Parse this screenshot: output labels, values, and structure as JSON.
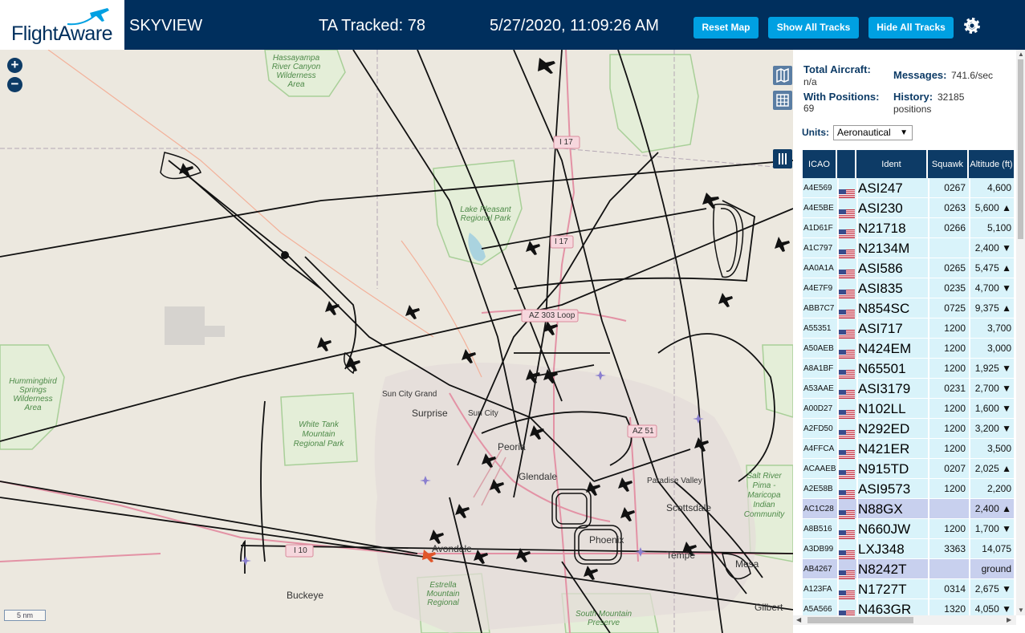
{
  "header": {
    "logo_text": "FlightAware",
    "app_name": "SKYVIEW",
    "ta_tracked": "TA Tracked: 78",
    "datetime": "5/27/2020, 11:09:26 AM",
    "reset_map_label": "Reset Map",
    "show_tracks_label": "Show All Tracks",
    "hide_tracks_label": "Hide All Tracks",
    "settings_icon": "gear-icon"
  },
  "map": {
    "zoom_in": "+",
    "zoom_out": "−",
    "scale_label": "5 nm",
    "labels": {
      "hassayampa": "Hassayampa River Canyon Wilderness Area",
      "lake_pleasant": "Lake Pleasant Regional Park",
      "hummingbird": "Hummingbird Springs Wilderness Area",
      "white_tank": "White Tank Mountain Regional Park",
      "sun_city_grand": "Sun City Grand",
      "surprise": "Surprise",
      "sun_city": "Sun City",
      "peoria": "Peoria",
      "glendale": "Glendale",
      "paradise_valley": "Paradise Valley",
      "scottsdale": "Scottsdale",
      "phoenix": "Phoenix",
      "tempe": "Tempe",
      "mesa": "Mesa",
      "avondale": "Avondale",
      "buckeye": "Buckeye",
      "estrella": "Estrella Mountain Regional",
      "south_mountain": "South Mountain Preserve",
      "salt_river": "Salt River Pima - Maricopa Indian Community",
      "gilbert": "Gilbert",
      "i17_a": "I 17",
      "i17_b": "I 17",
      "az303": "AZ 303 Loop",
      "az51": "AZ 51",
      "i10": "I 10"
    }
  },
  "panel": {
    "total_aircraft_label": "Total Aircraft:",
    "total_aircraft_value": "n/a",
    "with_positions_label": "With Positions:",
    "with_positions_value": "69",
    "messages_label": "Messages:",
    "messages_value": "741.6/sec",
    "history_label": "History:",
    "history_value": "32185 positions",
    "units_label": "Units:",
    "units_value": "Aeronautical"
  },
  "table": {
    "headers": [
      "ICAO",
      "Ident",
      "Squawk",
      "Altitude (ft)"
    ],
    "rows": [
      {
        "icao": "A4E569",
        "ident": "ASI247",
        "squawk": "0267",
        "alt": "4,600",
        "sel": false
      },
      {
        "icao": "A4E5BE",
        "ident": "ASI230",
        "squawk": "0263",
        "alt": "5,600 ▲",
        "sel": false
      },
      {
        "icao": "A1D61F",
        "ident": "N21718",
        "squawk": "0266",
        "alt": "5,100",
        "sel": false
      },
      {
        "icao": "A1C797",
        "ident": "N2134M",
        "squawk": "",
        "alt": "2,400 ▼",
        "sel": false
      },
      {
        "icao": "AA0A1A",
        "ident": "ASI586",
        "squawk": "0265",
        "alt": "5,475 ▲",
        "sel": false
      },
      {
        "icao": "A4E7F9",
        "ident": "ASI835",
        "squawk": "0235",
        "alt": "4,700 ▼",
        "sel": false
      },
      {
        "icao": "ABB7C7",
        "ident": "N854SC",
        "squawk": "0725",
        "alt": "9,375 ▲",
        "sel": false
      },
      {
        "icao": "A55351",
        "ident": "ASI717",
        "squawk": "1200",
        "alt": "3,700",
        "sel": false
      },
      {
        "icao": "A50AEB",
        "ident": "N424EM",
        "squawk": "1200",
        "alt": "3,000",
        "sel": false
      },
      {
        "icao": "A8A1BF",
        "ident": "N65501",
        "squawk": "1200",
        "alt": "1,925 ▼",
        "sel": false
      },
      {
        "icao": "A53AAE",
        "ident": "ASI3179",
        "squawk": "0231",
        "alt": "2,700 ▼",
        "sel": false
      },
      {
        "icao": "A00D27",
        "ident": "N102LL",
        "squawk": "1200",
        "alt": "1,600 ▼",
        "sel": false
      },
      {
        "icao": "A2FD50",
        "ident": "N292ED",
        "squawk": "1200",
        "alt": "3,200 ▼",
        "sel": false
      },
      {
        "icao": "A4FFCA",
        "ident": "N421ER",
        "squawk": "1200",
        "alt": "3,500",
        "sel": false
      },
      {
        "icao": "ACAAEB",
        "ident": "N915TD",
        "squawk": "0207",
        "alt": "2,025 ▲",
        "sel": false
      },
      {
        "icao": "A2E58B",
        "ident": "ASI9573",
        "squawk": "1200",
        "alt": "2,200",
        "sel": false
      },
      {
        "icao": "AC1C28",
        "ident": "N88GX",
        "squawk": "",
        "alt": "2,400 ▲",
        "sel": true
      },
      {
        "icao": "A8B516",
        "ident": "N660JW",
        "squawk": "1200",
        "alt": "1,700 ▼",
        "sel": false
      },
      {
        "icao": "A3DB99",
        "ident": "LXJ348",
        "squawk": "3363",
        "alt": "14,075 ▼",
        "sel": false
      },
      {
        "icao": "AB4267",
        "ident": "N8242T",
        "squawk": "",
        "alt": "ground",
        "sel": true
      },
      {
        "icao": "A123FA",
        "ident": "N1727T",
        "squawk": "0314",
        "alt": "2,675 ▼",
        "sel": false
      },
      {
        "icao": "A5A566",
        "ident": "N463GR",
        "squawk": "1320",
        "alt": "4,050 ▼",
        "sel": false
      }
    ]
  },
  "colors": {
    "header_bg": "#002f5d",
    "button_bg": "#00a0e2",
    "row_bg": "#d9f3fa",
    "row_selected_bg": "#c8d0ee"
  }
}
